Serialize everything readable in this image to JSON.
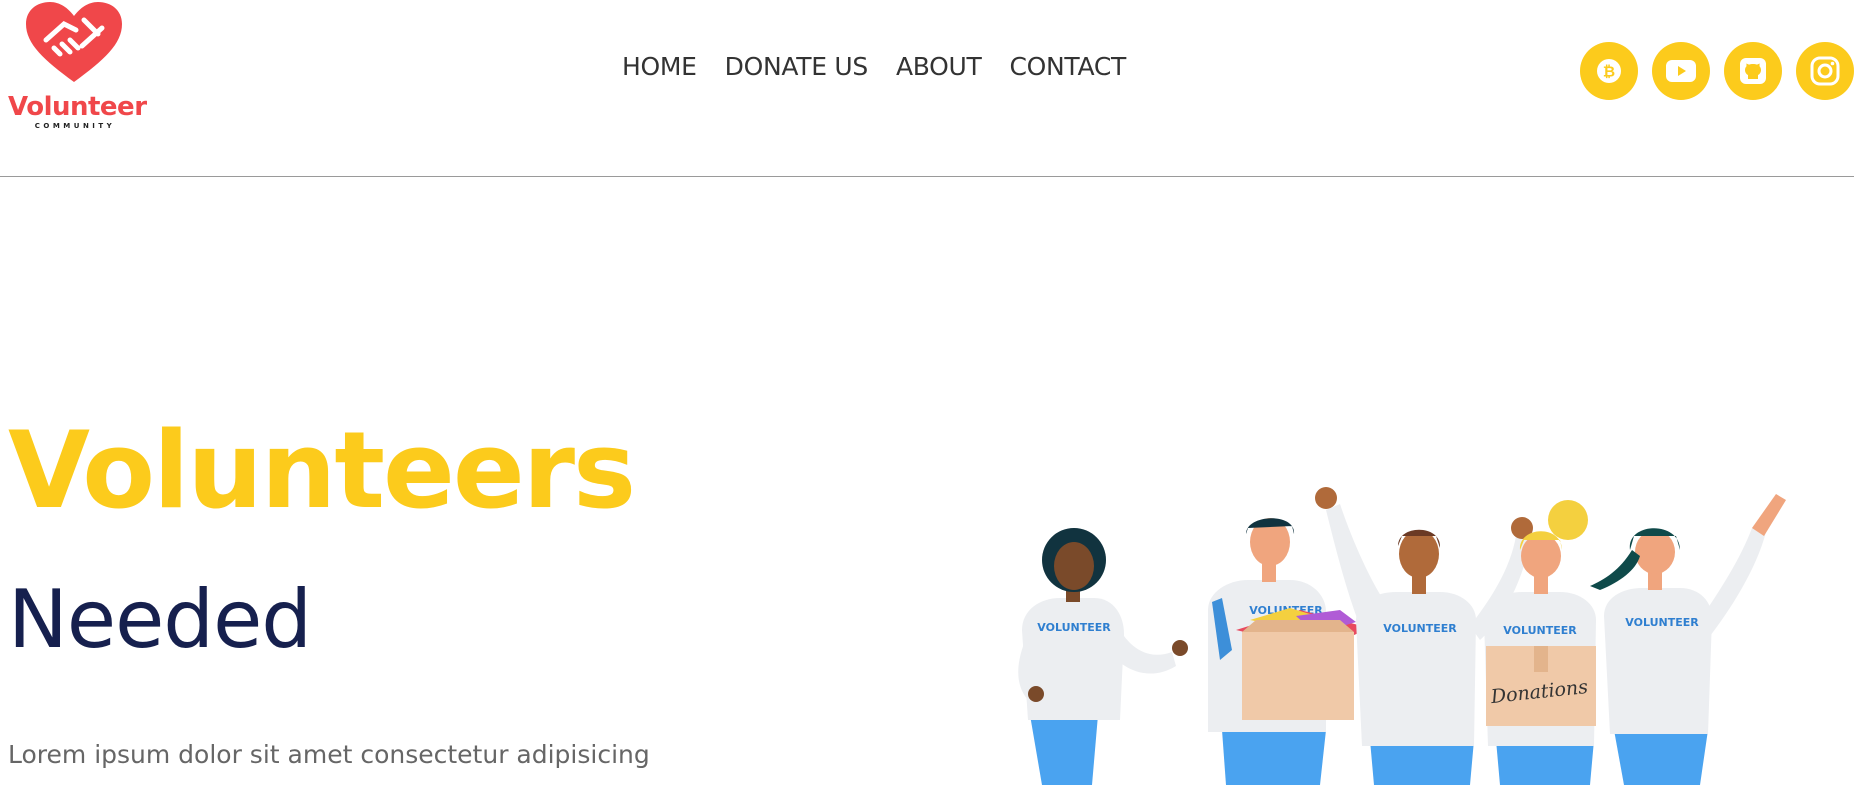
{
  "logo": {
    "name": "Volunteer",
    "tagline": "COMMUNITY"
  },
  "nav": [
    "HOME",
    "DONATE US",
    "ABOUT",
    "CONTACT"
  ],
  "social_icons": [
    "bitcoin-icon",
    "youtube-icon",
    "github-icon",
    "instagram-icon"
  ],
  "hero": {
    "title": "Volunteers",
    "subtitle": "Needed",
    "text": "Lorem ipsum dolor sit amet consectetur adipisicing"
  },
  "illustration": {
    "shirt_label": "VOLUNTEER",
    "box_label": "Donations"
  },
  "colors": {
    "accent": "#fccb1c",
    "brand": "#f0474a",
    "heading": "#16204e",
    "text": "#666666",
    "nav": "#333333"
  }
}
